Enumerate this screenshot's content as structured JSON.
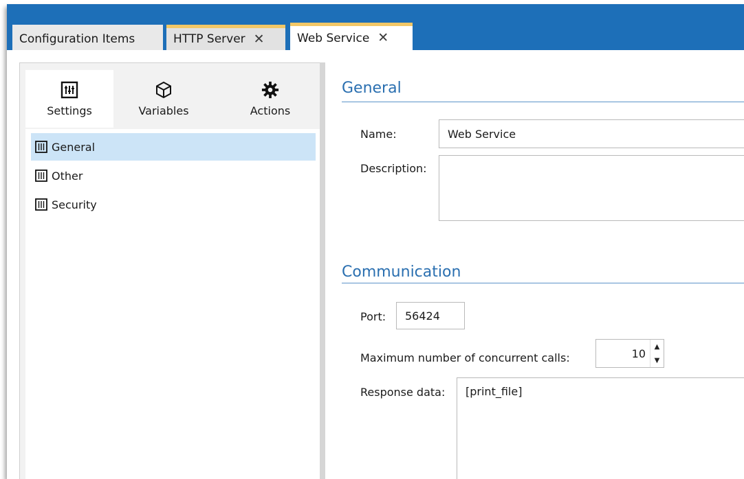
{
  "tabs": [
    {
      "label": "Configuration Items"
    },
    {
      "label": "HTTP Server",
      "close": "✕"
    },
    {
      "label": "Web Service",
      "close": "✕"
    }
  ],
  "side_tabs": [
    {
      "label": "Settings",
      "icon": "sliders-icon"
    },
    {
      "label": "Variables",
      "icon": "cube-icon"
    },
    {
      "label": "Actions",
      "icon": "gear-icon"
    }
  ],
  "tree": [
    {
      "label": "General",
      "selected": true
    },
    {
      "label": "Other"
    },
    {
      "label": "Security"
    }
  ],
  "general": {
    "title": "General",
    "name_label": "Name:",
    "name_value": "Web Service",
    "description_label": "Description:",
    "description_value": ""
  },
  "communication": {
    "title": "Communication",
    "port_label": "Port:",
    "port_value": "56424",
    "max_calls_label": "Maximum number of concurrent calls:",
    "max_calls_value": "10",
    "response_label": "Response data:",
    "response_value": "[print_file]"
  },
  "colors": {
    "tabbar": "#1d6fb8",
    "tab_accent": "#f2c766",
    "section_title": "#2a6fb0",
    "selected_item": "#cce4f7"
  }
}
